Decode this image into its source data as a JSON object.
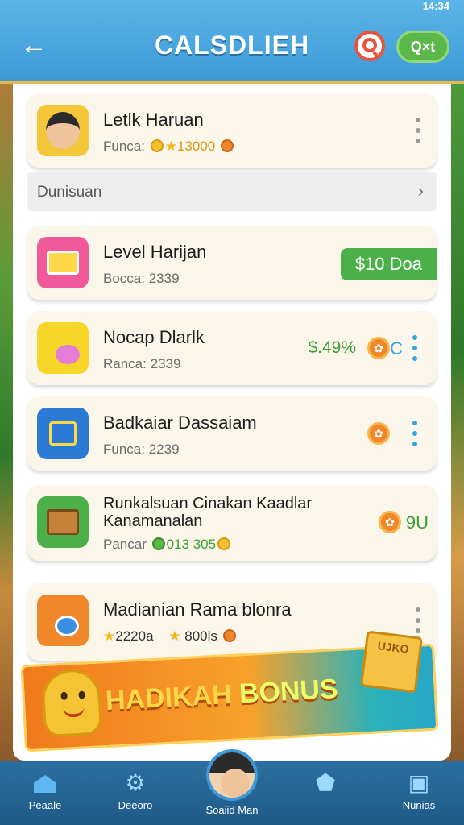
{
  "status_bar": {
    "time": "14:34"
  },
  "header": {
    "title": "CALSDLIEH",
    "exit_label": "Q×t"
  },
  "cards": [
    {
      "name": "Letlk Haruan",
      "sub_prefix": "Funca:",
      "sub_value": "13000",
      "icon": "avatar-icon",
      "color": "#f4c63a"
    },
    {
      "name": "Level Harijan",
      "sub_prefix": "Bocca:",
      "sub_value": "2339",
      "icon": "gift-icon",
      "color": "#f15a9a",
      "price": "$10 Doa"
    },
    {
      "name": "Nocap Dlarlk",
      "sub_prefix": "Ranca:",
      "sub_value": "2339",
      "icon": "note-icon",
      "color": "#f7d62a",
      "price": "$.49%",
      "coin": "C"
    },
    {
      "name": "Badkaiar Dassaiam",
      "sub_prefix": "Funca:",
      "sub_value": "2239",
      "icon": "blue-box-icon",
      "color": "#2b7bd6"
    },
    {
      "name": "Runkalsuan Cinakan Kaadlar Kanamanalan",
      "sub_prefix": "Pancar",
      "sub_value": "013 305",
      "icon": "crate-icon",
      "color": "#4cb04a",
      "side": "9U"
    },
    {
      "name": "Madianian Rama blonra",
      "sub_prefix": "2220a",
      "sub_value": "800ls",
      "icon": "chat-icon",
      "color": "#f0872a"
    }
  ],
  "section": {
    "label": "Dunisuan"
  },
  "banner": {
    "text_part1": "HADIKAH",
    "text_part2": "BONUS",
    "crate_text": "UJKO"
  },
  "nav": [
    {
      "label": "Peaale",
      "icon": "home-icon"
    },
    {
      "label": "Deeoro",
      "icon": "gear-icon"
    },
    {
      "label": "Soaiid Man",
      "icon": "avatar-icon"
    },
    {
      "label": "",
      "icon": "shield-icon"
    },
    {
      "label": "Nunias",
      "icon": "bag-icon"
    }
  ]
}
